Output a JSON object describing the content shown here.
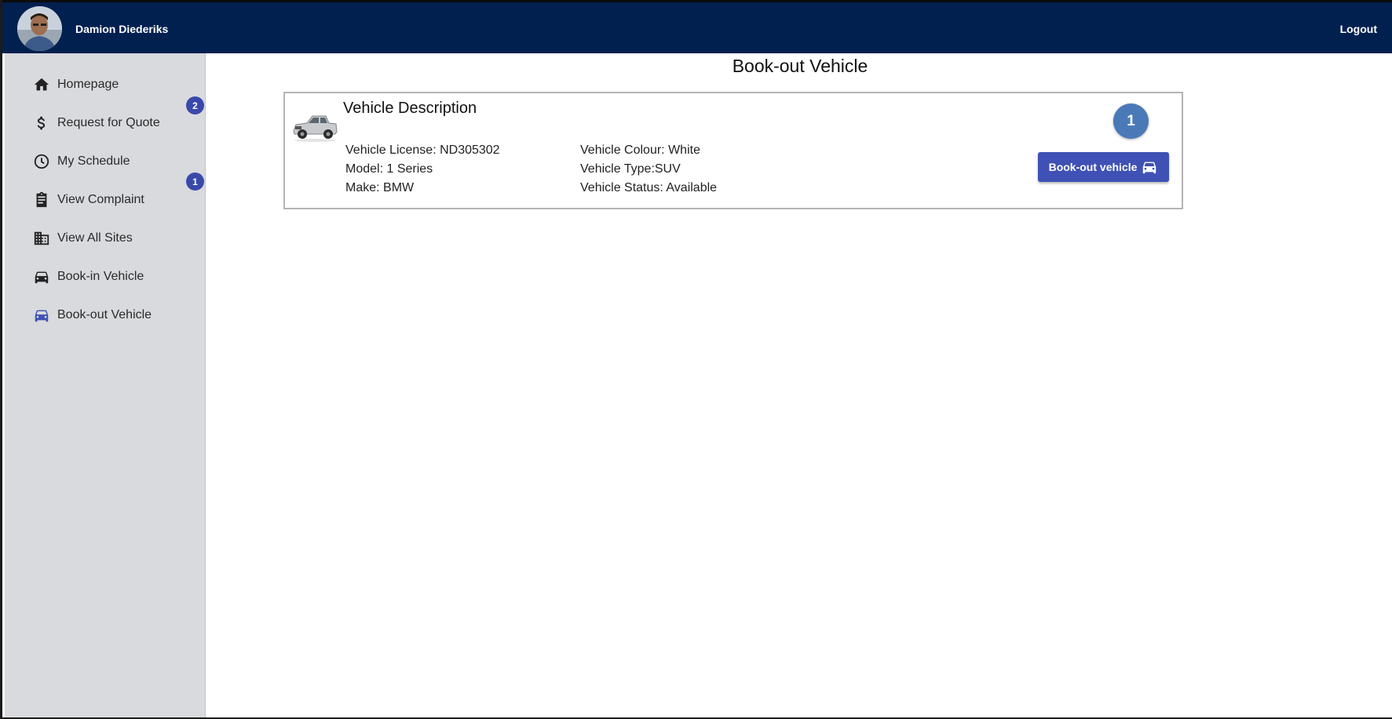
{
  "header": {
    "user_name": "Damion Diederiks",
    "logout_label": "Logout",
    "background": "#012050"
  },
  "sidebar": {
    "items": [
      {
        "label": "Homepage",
        "icon": "home-icon"
      },
      {
        "label": "Request for Quote",
        "icon": "dollar-icon",
        "badge": "2"
      },
      {
        "label": "My Schedule",
        "icon": "clock-icon"
      },
      {
        "label": "View Complaint",
        "icon": "clipboard-icon",
        "badge": "1"
      },
      {
        "label": "View All Sites",
        "icon": "building-icon"
      },
      {
        "label": "Book-in Vehicle",
        "icon": "car-icon"
      },
      {
        "label": "Book-out Vehicle",
        "icon": "car-icon",
        "active": true
      }
    ],
    "accent": "#3949ab"
  },
  "main": {
    "title": "Book-out Vehicle",
    "card": {
      "heading": "Vehicle Description",
      "thumbnail": "pickup-truck-image",
      "license": "Vehicle License: ND305302",
      "model": "Model: 1 Series",
      "make": "Make: BMW",
      "colour": "Vehicle Colour: White",
      "type": "Vehicle Type:SUV",
      "status": "Vehicle Status: Available",
      "count": "1",
      "button_label": "Book-out vehicle",
      "button_color": "#3f51b5"
    }
  }
}
